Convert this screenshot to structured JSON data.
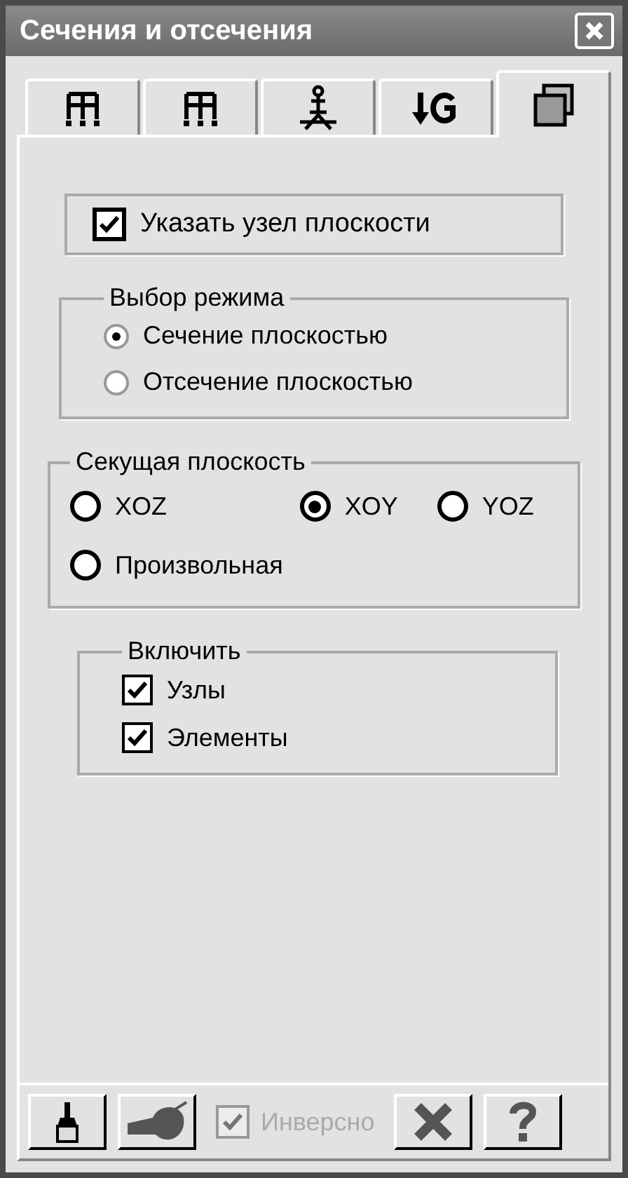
{
  "window": {
    "title": "Сечения и отсечения"
  },
  "tabs": [
    {
      "kind": "frame",
      "selected": false
    },
    {
      "kind": "frame",
      "selected": false
    },
    {
      "kind": "tower",
      "selected": false
    },
    {
      "kind": "load",
      "selected": false
    },
    {
      "kind": "layers",
      "selected": true
    }
  ],
  "node_check": {
    "label": "Указать узел плоскости",
    "checked": true
  },
  "mode_group": {
    "title": "Выбор режима",
    "options": [
      {
        "label": "Сечение плоскостью",
        "selected": true
      },
      {
        "label": "Отсечение плоскостью",
        "selected": false
      }
    ]
  },
  "plane_group": {
    "title": "Секущая плоскость",
    "options": [
      {
        "label": "XOZ",
        "selected": false
      },
      {
        "label": "XOY",
        "selected": true
      },
      {
        "label": "YOZ",
        "selected": false
      },
      {
        "label": "Произвольная",
        "selected": false
      }
    ]
  },
  "include_group": {
    "title": "Включить",
    "items": [
      {
        "label": "Узлы",
        "checked": true
      },
      {
        "label": "Элементы",
        "checked": true
      }
    ]
  },
  "toolbar": {
    "buttons": [
      {
        "kind": "brush"
      },
      {
        "kind": "fill"
      }
    ],
    "inverse": {
      "label": "Инверсно",
      "checked": true,
      "disabled": true
    },
    "end_buttons": [
      {
        "kind": "close"
      },
      {
        "kind": "help"
      }
    ]
  }
}
